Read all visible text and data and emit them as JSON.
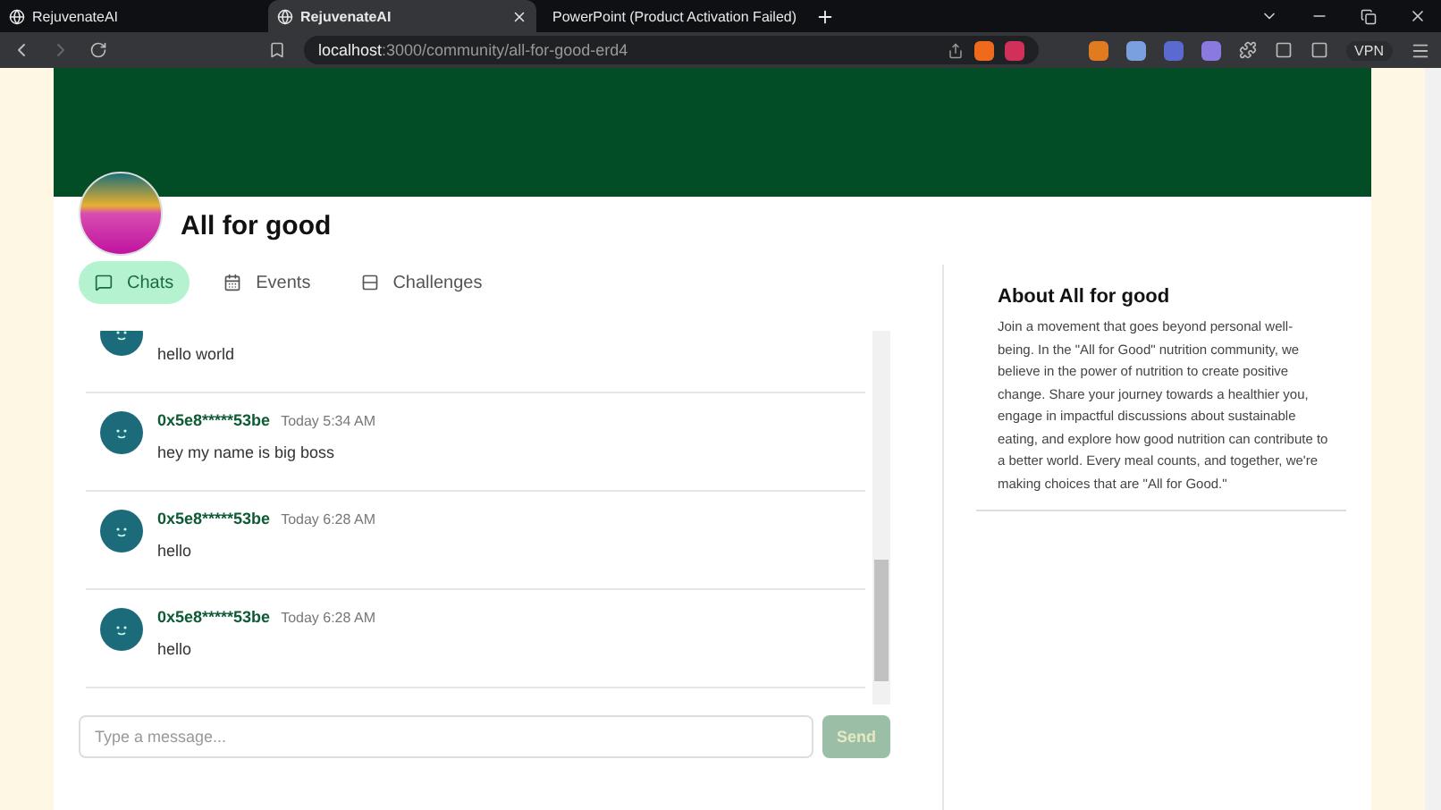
{
  "browser": {
    "tabs": [
      {
        "title": "RejuvenateAI",
        "selected": false
      },
      {
        "title": "RejuvenateAI",
        "selected": true
      },
      {
        "title": "PowerPoint (Product Activation Failed)",
        "selected": false
      }
    ],
    "url_host": "localhost",
    "url_path": ":3000/community/all-for-good-erd4",
    "vpn_label": "VPN"
  },
  "community": {
    "name": "All for good",
    "tabs": [
      {
        "label": "Chats",
        "kind": "chat",
        "selected": true
      },
      {
        "label": "Events",
        "kind": "calendar",
        "selected": false
      },
      {
        "label": "Challenges",
        "kind": "list",
        "selected": false
      }
    ],
    "messages": [
      {
        "text": "hello world"
      },
      {
        "author": "0x5e8*****53be",
        "time": "Today 5:34 AM",
        "text": "hey my name is big boss"
      },
      {
        "author": "0x5e8*****53be",
        "time": "Today 6:28 AM",
        "text": "hello"
      },
      {
        "author": "0x5e8*****53be",
        "time": "Today 6:28 AM",
        "text": "hello"
      }
    ],
    "composer": {
      "placeholder": "Type a message...",
      "send_label": "Send",
      "send_disabled": true
    },
    "about": {
      "title": "About All for good",
      "body": "Join a movement that goes beyond personal well-being. In the \"All for Good\" nutrition community, we believe in the power of nutrition to create positive change. Share your journey towards a healthier you, engage in impactful discussions about sustainable eating, and explore how good nutrition can contribute to a better world. Every meal counts, and together, we're making choices that are \"All for Good.\""
    }
  }
}
